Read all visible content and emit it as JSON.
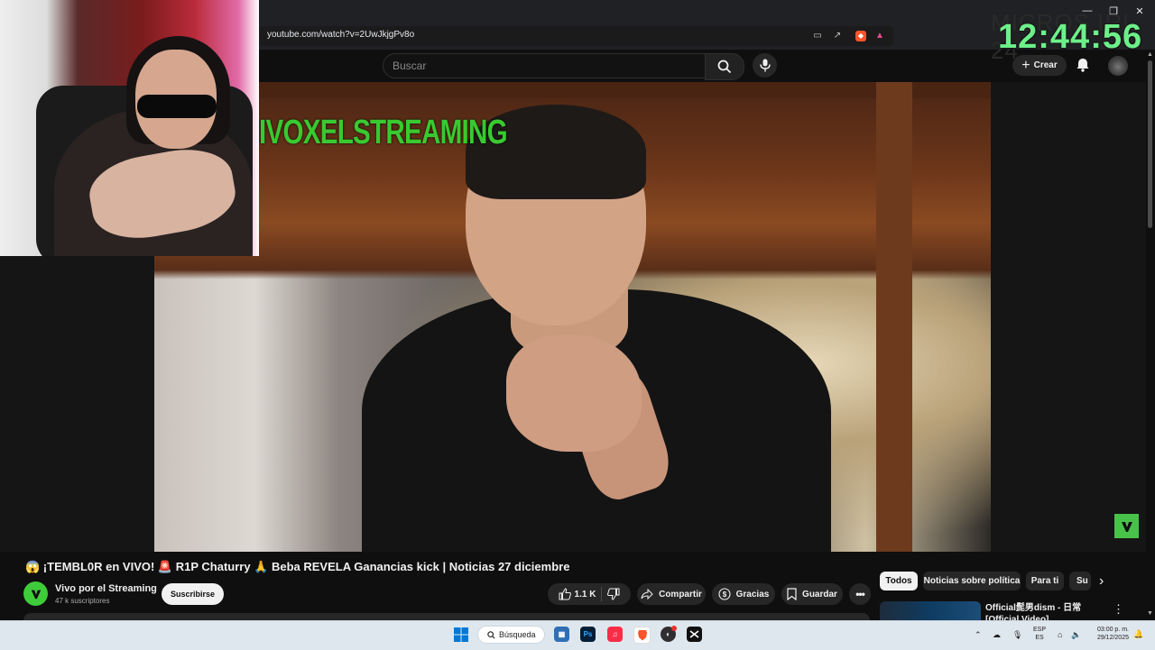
{
  "browser": {
    "url": "youtube.com/watch?v=2UwJkjgPv8o",
    "window_controls": [
      "—",
      "❐",
      "✕"
    ]
  },
  "overlay": {
    "clock": "12:44:56",
    "background_text": "MICROS IRL 24",
    "clock_color": "#6df08a"
  },
  "header": {
    "search_placeholder": "Buscar",
    "create_label": "Crear"
  },
  "video": {
    "watermark_text": "IVOXELSTREAMING",
    "watermark_color": "#39c930"
  },
  "details": {
    "title": "😱 ¡TEMBL0R en VIVO! 🚨 R1P Chaturry 🙏 Beba REVELA Ganancias kick | Noticias 27 diciembre",
    "channel_name": "Vivo por el Streaming",
    "subscribers": "47 k suscriptores",
    "subscribe_label": "Suscribirse",
    "like_count": "1.1 K",
    "share_label": "Compartir",
    "thanks_label": "Gracias",
    "save_label": "Guardar"
  },
  "sidebar": {
    "chips": [
      "Todos",
      "Noticias sobre política",
      "Para ti",
      "Su"
    ],
    "recommendation_title": "Official髭男dism - 日常 [Official Video]"
  },
  "taskbar": {
    "search_label": "Búsqueda",
    "language": [
      "ESP",
      "ES"
    ],
    "time": "03:00 p. m.",
    "date": "29/12/2025",
    "apps": [
      "windows-start",
      "widgets",
      "photoshop",
      "apple-music",
      "brave",
      "obs",
      "capcut"
    ]
  }
}
